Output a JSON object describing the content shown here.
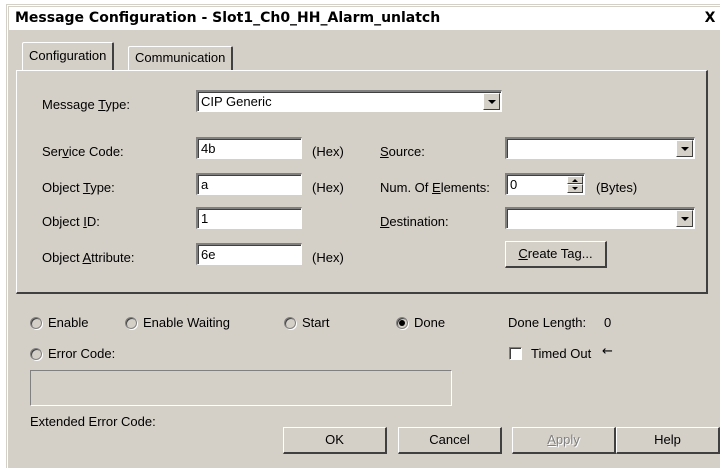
{
  "window": {
    "title": "Message Configuration - Slot1_Ch0_HH_Alarm_unlatch",
    "close_glyph": "X"
  },
  "tabs": [
    {
      "label": "Configuration",
      "active": true
    },
    {
      "label": "Communication",
      "active": false
    }
  ],
  "config": {
    "message_type": {
      "label_pre": "Message ",
      "label_key": "T",
      "label_post": "ype:",
      "value": "CIP Generic"
    },
    "service_code": {
      "label_pre": "Ser",
      "label_key": "v",
      "label_post": "ice Code:",
      "value": "4b",
      "unit": "(Hex)"
    },
    "object_type": {
      "label_pre": "Object ",
      "label_key": "T",
      "label_post": "ype:",
      "value": "a",
      "unit": "(Hex)"
    },
    "object_id": {
      "label_pre": "Object ",
      "label_key": "I",
      "label_post": "D:",
      "value": "1"
    },
    "object_attribute": {
      "label_pre": "Object ",
      "label_key": "A",
      "label_post": "ttribute:",
      "value": "6e",
      "unit": "(Hex)"
    },
    "source": {
      "label_pre": "",
      "label_key": "S",
      "label_post": "ource:",
      "value": ""
    },
    "num_elements": {
      "label_pre": "Num. Of ",
      "label_key": "E",
      "label_post": "lements:",
      "value": "0",
      "unit": "(Bytes)"
    },
    "destination": {
      "label_pre": "",
      "label_key": "D",
      "label_post": "estination:",
      "value": ""
    },
    "create_tag": {
      "label_pre": "",
      "label_key": "C",
      "label_post": "reate Tag..."
    }
  },
  "status": {
    "enable": {
      "label": "Enable",
      "selected": false
    },
    "enable_waiting": {
      "label": "Enable Waiting",
      "selected": false
    },
    "start": {
      "label": "Start",
      "selected": false
    },
    "done": {
      "label": "Done",
      "selected": true
    },
    "done_length_label": "Done Length:",
    "done_length_value": "0",
    "error_code": {
      "label": "Error Code:",
      "selected": false
    },
    "timed_out": {
      "label": "Timed Out",
      "checked": false,
      "arrow": "←"
    },
    "extended_error_label": "Extended Error Code:"
  },
  "buttons": {
    "ok": "OK",
    "cancel": "Cancel",
    "apply_key": "A",
    "apply_post": "pply",
    "help": "Help"
  },
  "colors": {
    "face": "#d4d0c8",
    "highlight": "#ffffff",
    "shadow": "#808080",
    "dark_shadow": "#404040",
    "disabled_text": "#808080"
  },
  "icons": {
    "close": "close-icon",
    "dropdown": "chevron-down-icon",
    "spinner": "spinner-arrows-icon",
    "timed_out_arrow": "arrow-left-icon"
  }
}
